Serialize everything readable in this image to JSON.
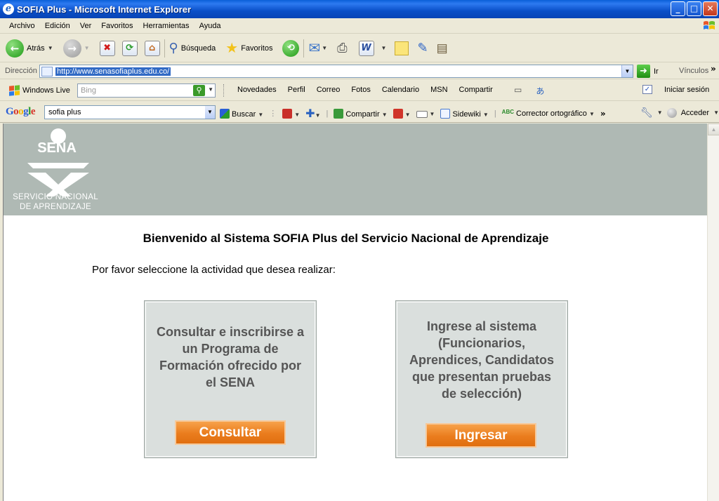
{
  "window": {
    "title": "SOFIA Plus - Microsoft Internet Explorer",
    "controls": {
      "minimize": "_",
      "maximize": "□",
      "close": "✕"
    }
  },
  "menu": {
    "items": [
      "Archivo",
      "Edición",
      "Ver",
      "Favoritos",
      "Herramientas",
      "Ayuda"
    ]
  },
  "toolbar": {
    "back_label": "Atrás",
    "search_label": "Búsqueda",
    "favorites_label": "Favoritos"
  },
  "address_bar": {
    "label": "Dirección",
    "url": "http://www.senasofiaplus.edu.co/",
    "go_label": "Ir",
    "links_label": "Vínculos"
  },
  "live_toolbar": {
    "brand": "Windows Live",
    "search_placeholder": "Bing",
    "links": [
      "Novedades",
      "Perfil",
      "Correo",
      "Fotos",
      "Calendario",
      "MSN",
      "Compartir"
    ],
    "signin_label": "Iniciar sesión"
  },
  "google_toolbar": {
    "search_value": "sofia plus",
    "buscar_label": "Buscar",
    "compartir_label": "Compartir",
    "sidewiki_label": "Sidewiki",
    "corrector_label": "Corrector ortográfico",
    "acceder_label": "Acceder"
  },
  "page": {
    "logo_text": "SENA",
    "logo_line1": "SERVICIO NACIONAL",
    "logo_line2": "DE APRENDIZAJE",
    "welcome": "Bienvenido al Sistema SOFIA Plus del Servicio Nacional de Aprendizaje",
    "prompt": "Por favor seleccione la actividad que desea realizar:",
    "left_panel": {
      "lines": [
        "Consultar e inscribirse a",
        "un Programa de",
        "Formación ofrecido por",
        "el SENA"
      ],
      "button": "Consultar"
    },
    "right_panel": {
      "lines": [
        "Ingrese al sistema",
        "(Funcionarios,",
        "Aprendices, Candidatos",
        "que presentan pruebas",
        "de selección)"
      ],
      "button": "Ingresar"
    }
  },
  "colors": {
    "banner": "#afb9b4",
    "panel": "#dadfdd",
    "button_orange": "#ea7c1d",
    "titlebar_blue": "#0a5fd8"
  }
}
